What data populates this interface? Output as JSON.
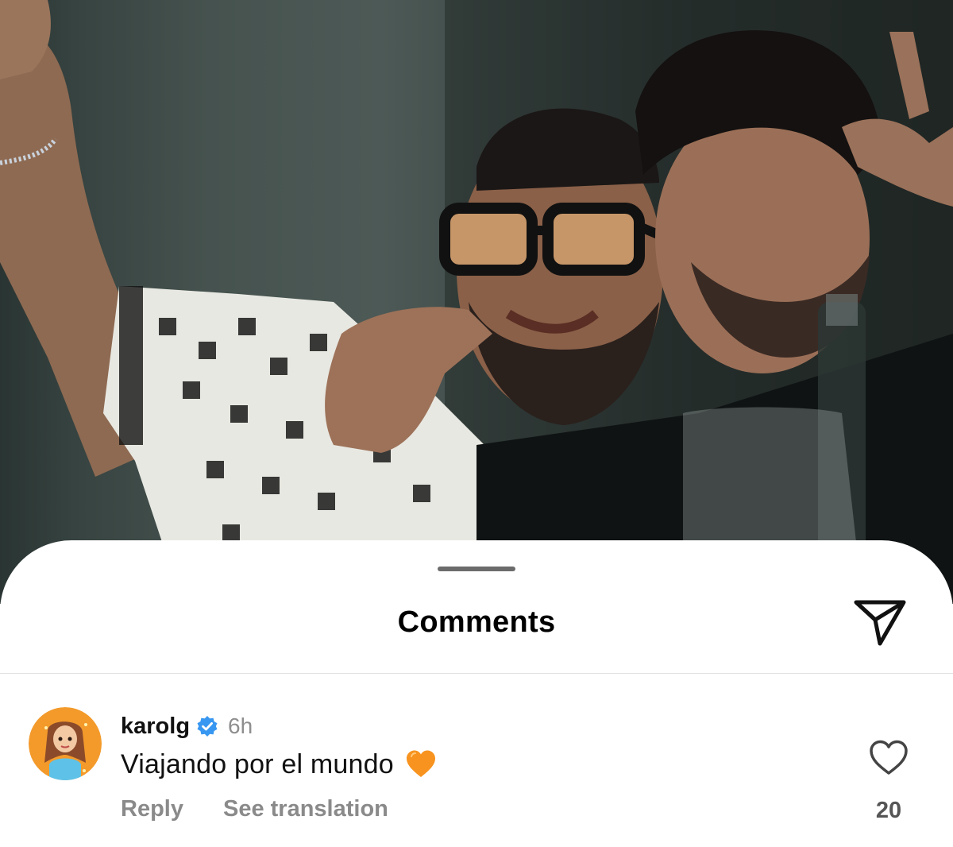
{
  "sheet": {
    "title": "Comments"
  },
  "comment": {
    "username": "karolg",
    "verified": true,
    "time_ago": "6h",
    "text": "Viajando por el mundo",
    "emoji": "orange-heart-emoji",
    "reply_label": "Reply",
    "translation_label": "See translation",
    "like_count": "20"
  },
  "colors": {
    "verified_badge": "#3897f0",
    "avatar_background": "#f39a2b",
    "heart_emoji": "#f7931e",
    "secondary_text": "#8e8e8e"
  },
  "icons": {
    "share": "paper-plane-icon",
    "like": "heart-outline-icon",
    "verified": "verified-badge-icon"
  }
}
